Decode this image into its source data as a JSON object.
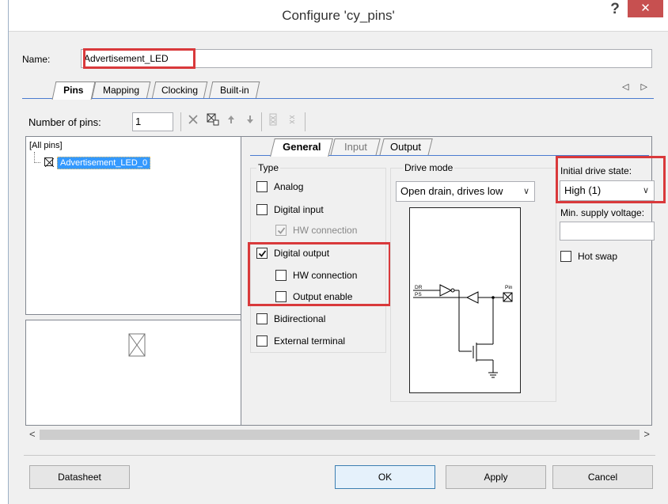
{
  "window": {
    "title": "Configure 'cy_pins'",
    "help_glyph": "?",
    "close_glyph": "✕"
  },
  "name": {
    "label": "Name:",
    "value": "Advertisement_LED"
  },
  "tabs": [
    {
      "label": "Pins",
      "active": true
    },
    {
      "label": "Mapping"
    },
    {
      "label": "Clocking"
    },
    {
      "label": "Built-in"
    }
  ],
  "tab_nav": "◁ ▷",
  "toolbar": {
    "num_pins_label": "Number of pins:",
    "num_pins_value": "1",
    "icons": [
      "delete-icon",
      "ungroup-icon",
      "move-up-icon",
      "move-down-icon",
      "group-pins-icon",
      "ungroup-pins-icon"
    ]
  },
  "tree": {
    "root": "[All pins]",
    "items": [
      "Advertisement_LED_0"
    ]
  },
  "inner_tabs": [
    {
      "label": "General",
      "active": true
    },
    {
      "label": "Input",
      "dim": true
    },
    {
      "label": "Output"
    }
  ],
  "type_group": {
    "title": "Type",
    "options": [
      {
        "label": "Analog",
        "checked": false
      },
      {
        "label": "Digital input",
        "checked": false
      },
      {
        "label": "HW connection",
        "checked": true,
        "disabled": true
      },
      {
        "label": "Digital output",
        "checked": true
      },
      {
        "label": "HW connection",
        "checked": false
      },
      {
        "label": "Output enable",
        "checked": false
      },
      {
        "label": "Bidirectional",
        "checked": false
      },
      {
        "label": "External terminal",
        "checked": false
      }
    ]
  },
  "drive_mode": {
    "title": "Drive mode",
    "value": "Open drain, drives low",
    "schematic": {
      "dr_label": "DR",
      "ps_label": "PS",
      "pin_label": "Pin"
    }
  },
  "initial_drive": {
    "label": "Initial drive state:",
    "value": "High (1)"
  },
  "min_supply": {
    "label": "Min. supply voltage:",
    "value": ""
  },
  "hot_swap": {
    "label": "Hot swap",
    "checked": false
  },
  "scroll": {
    "left": "<",
    "right": ">"
  },
  "buttons": {
    "datasheet": "Datasheet",
    "ok": "OK",
    "apply": "Apply",
    "cancel": "Cancel"
  },
  "colors": {
    "highlight": "#d9393b",
    "selection": "#3399ff",
    "close": "#c75050"
  }
}
